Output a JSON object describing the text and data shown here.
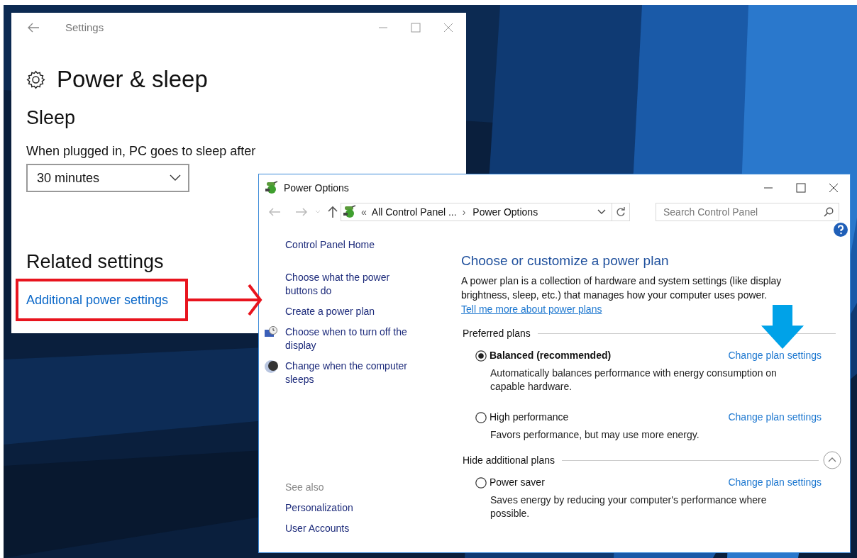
{
  "settings_window": {
    "title": "Settings",
    "heading": "Power & sleep",
    "section": "Sleep",
    "label": "When plugged in, PC goes to sleep after",
    "dropdown_value": "30 minutes",
    "related_heading": "Related settings",
    "link": "Additional power settings"
  },
  "power_options_window": {
    "title": "Power Options",
    "address": {
      "overflow": "«",
      "items": [
        "All Control Panel ...",
        "Power Options"
      ],
      "separator": "›"
    },
    "search": {
      "placeholder": "Search Control Panel"
    },
    "sidebar": {
      "home": "Control Panel Home",
      "items": [
        {
          "label": "Choose what the power buttons do",
          "kind": "plain"
        },
        {
          "label": "Create a power plan",
          "kind": "plain"
        },
        {
          "label": "Choose when to turn off the display",
          "kind": "display"
        },
        {
          "label": "Change when the computer sleeps",
          "kind": "sleep"
        }
      ],
      "see_also_heading": "See also",
      "see_also": [
        "Personalization",
        "User Accounts"
      ]
    },
    "heading": "Choose or customize a power plan",
    "description": "A power plan is a collection of hardware and system settings (like display brightness, sleep, etc.) that manages how your computer uses power.",
    "description_link": "Tell me more about power plans",
    "groups": [
      {
        "title": "Preferred plans",
        "kind": "plain",
        "plans": [
          {
            "name": "Balanced (recommended)",
            "selected": true,
            "description": "Automatically balances performance with energy consumption on capable hardware.",
            "action": "Change plan settings"
          },
          {
            "name": "High performance",
            "selected": false,
            "description": "Favors performance, but may use more energy.",
            "action": "Change plan settings"
          }
        ]
      },
      {
        "title": "Hide additional plans",
        "kind": "collapsible",
        "expanded": true,
        "plans": [
          {
            "name": "Power saver",
            "selected": false,
            "description": "Saves energy by reducing your computer's performance where possible.",
            "action": "Change plan settings"
          }
        ]
      }
    ]
  }
}
